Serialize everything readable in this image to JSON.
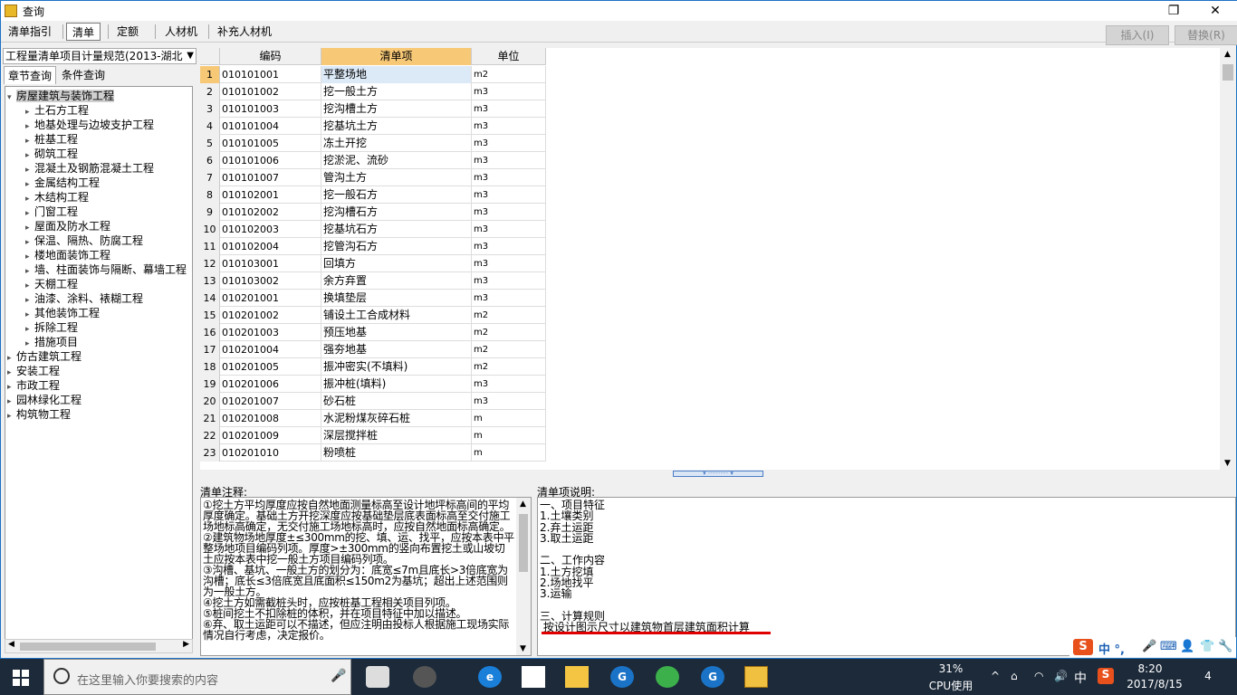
{
  "window": {
    "title": "查询",
    "min": "—",
    "restore": "❐",
    "close": "✕"
  },
  "tabs": [
    "清单指引",
    "清单",
    "定额",
    "人材机",
    "补充人材机"
  ],
  "actions": {
    "insert": "插入(I)",
    "replace": "替换(R)"
  },
  "left": {
    "spec": "工程量清单项目计量规范(2013-湖北",
    "tabs": [
      "章节查询",
      "条件查询"
    ],
    "tree": [
      {
        "label": "房屋建筑与装饰工程",
        "level": 0,
        "open": true,
        "sel": true
      },
      {
        "label": "土石方工程",
        "level": 1
      },
      {
        "label": "地基处理与边坡支护工程",
        "level": 1
      },
      {
        "label": "桩基工程",
        "level": 1
      },
      {
        "label": "砌筑工程",
        "level": 1
      },
      {
        "label": "混凝土及钢筋混凝土工程",
        "level": 1
      },
      {
        "label": "金属结构工程",
        "level": 1
      },
      {
        "label": "木结构工程",
        "level": 1
      },
      {
        "label": "门窗工程",
        "level": 1
      },
      {
        "label": "屋面及防水工程",
        "level": 1
      },
      {
        "label": "保温、隔热、防腐工程",
        "level": 1
      },
      {
        "label": "楼地面装饰工程",
        "level": 1
      },
      {
        "label": "墙、柱面装饰与隔断、幕墙工程",
        "level": 1
      },
      {
        "label": "天棚工程",
        "level": 1
      },
      {
        "label": "油漆、涂料、裱糊工程",
        "level": 1
      },
      {
        "label": "其他装饰工程",
        "level": 1
      },
      {
        "label": "拆除工程",
        "level": 1
      },
      {
        "label": "措施项目",
        "level": 1
      },
      {
        "label": "仿古建筑工程",
        "level": 0
      },
      {
        "label": "安装工程",
        "level": 0
      },
      {
        "label": "市政工程",
        "level": 0
      },
      {
        "label": "园林绿化工程",
        "level": 0
      },
      {
        "label": "构筑物工程",
        "level": 0
      }
    ]
  },
  "grid": {
    "headers": [
      "编码",
      "清单项",
      "单位"
    ],
    "rows": [
      [
        "1",
        "010101001",
        "平整场地",
        "m2"
      ],
      [
        "2",
        "010101002",
        "挖一般土方",
        "m3"
      ],
      [
        "3",
        "010101003",
        "挖沟槽土方",
        "m3"
      ],
      [
        "4",
        "010101004",
        "挖基坑土方",
        "m3"
      ],
      [
        "5",
        "010101005",
        "冻土开挖",
        "m3"
      ],
      [
        "6",
        "010101006",
        "挖淤泥、流砂",
        "m3"
      ],
      [
        "7",
        "010101007",
        "管沟土方",
        "m3"
      ],
      [
        "8",
        "010102001",
        "挖一般石方",
        "m3"
      ],
      [
        "9",
        "010102002",
        "挖沟槽石方",
        "m3"
      ],
      [
        "10",
        "010102003",
        "挖基坑石方",
        "m3"
      ],
      [
        "11",
        "010102004",
        "挖管沟石方",
        "m3"
      ],
      [
        "12",
        "010103001",
        "回填方",
        "m3"
      ],
      [
        "13",
        "010103002",
        "余方弃置",
        "m3"
      ],
      [
        "14",
        "010201001",
        "换填垫层",
        "m3"
      ],
      [
        "15",
        "010201002",
        "铺设土工合成材料",
        "m2"
      ],
      [
        "16",
        "010201003",
        "预压地基",
        "m2"
      ],
      [
        "17",
        "010201004",
        "强夯地基",
        "m2"
      ],
      [
        "18",
        "010201005",
        "振冲密实(不填料)",
        "m2"
      ],
      [
        "19",
        "010201006",
        "振冲桩(填料)",
        "m3"
      ],
      [
        "20",
        "010201007",
        "砂石桩",
        "m3"
      ],
      [
        "21",
        "010201008",
        "水泥粉煤灰碎石桩",
        "m"
      ],
      [
        "22",
        "010201009",
        "深层搅拌桩",
        "m"
      ],
      [
        "23",
        "010201010",
        "粉喷桩",
        "m"
      ]
    ]
  },
  "notes": {
    "label": "清单注释:",
    "text": "①挖土方平均厚度应按自然地面测量标高至设计地坪标高间的平均厚度确定。基础土方开挖深度应按基础垫层底表面标高至交付施工场地标高确定，无交付施工场地标高时，应按自然地面标高确定。\n②建筑物场地厚度±≤300mm的挖、填、运、找平，应按本表中平整场地项目编码列项。厚度>±300mm的竖向布置挖土或山坡切土应按本表中挖一般土方项目编码列项。\n③沟槽、基坑、一般土方的划分为：底宽≤7m且底长>3倍底宽为沟槽；底长≤3倍底宽且底面积≤150m2为基坑；超出上述范围则为一般土方。\n④挖土方如需截桩头时，应按桩基工程相关项目列项。\n⑤桩间挖土不扣除桩的体积，并在项目特征中加以描述。\n⑥弃、取土运距可以不描述，但应注明由投标人根据施工现场实际情况自行考虑，决定报价。"
  },
  "desc": {
    "label": "清单项说明:",
    "text": "一、项目特征\n1.土壤类别\n2.弃土运距\n3.取土运距\n\n二、工作内容\n1.土方挖填\n2.场地找平\n3.运输\n\n三、计算规则\n 按设计图示尺寸以建筑物首层建筑面积计算"
  },
  "ime": {
    "text": "中 °,"
  },
  "taskbar": {
    "search_placeholder": "在这里输入你要搜索的内容",
    "cpu": "31%",
    "cpu_label": "CPU使用",
    "lang": "中",
    "time": "8:20",
    "date": "2017/8/15",
    "notif": "4"
  }
}
